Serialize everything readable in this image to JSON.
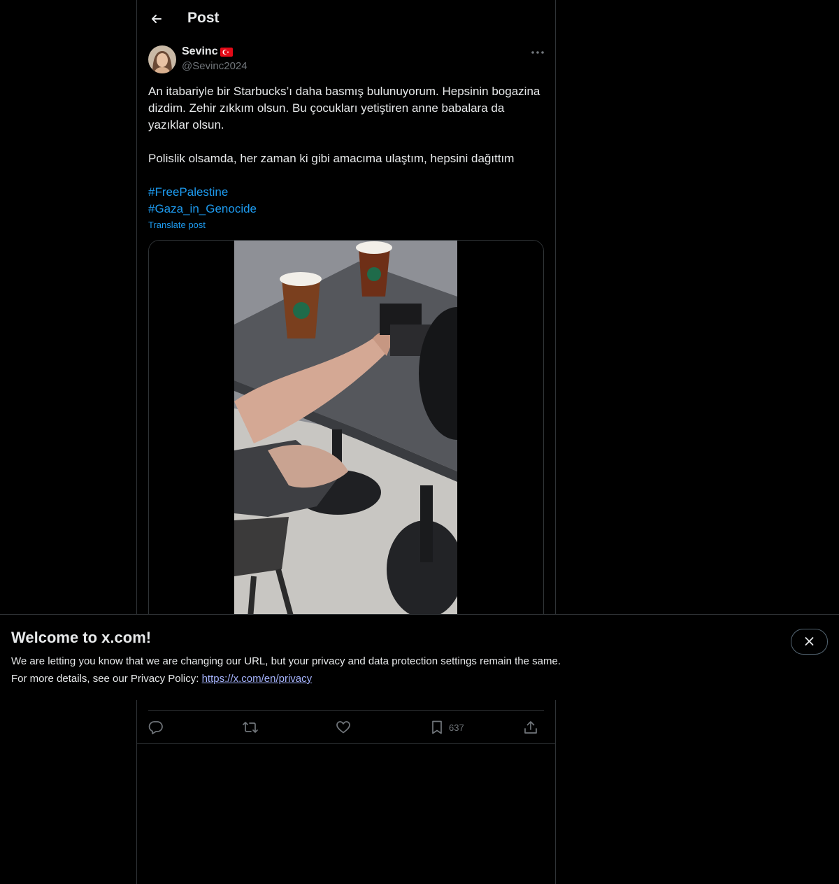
{
  "header": {
    "title": "Post"
  },
  "author": {
    "name": "Sevinc",
    "handle": "@Sevinc2024"
  },
  "post": {
    "paragraphs": [
      "An itabariyle bir Starbucks’ı daha basmış bulunuyorum. Hepsinin bogazina dizdim. Zehir zıkkım olsun. Bu çocukları yetiştiren anne babalara da yazıklar olsun.",
      "Polislik olsamda, her zaman ki gibi amacıma ulaştım, hepsini dağıttım"
    ],
    "hashtags": [
      "#FreePalestine",
      "#Gaza_in_Genocide"
    ],
    "translate_label": "Translate post"
  },
  "actions": {
    "reply_count": "",
    "repost_count": "",
    "like_count": "",
    "bookmark_count": "637"
  },
  "banner": {
    "title": "Welcome to x.com!",
    "line1": "We are letting you know that we are changing our URL, but your privacy and data protection settings remain the same.",
    "line2_prefix": "For more details, see our Privacy Policy: ",
    "link": "https://x.com/en/privacy"
  },
  "icons": {
    "back": "arrow-left-icon",
    "more": "more-horizontal-icon",
    "reply": "reply-icon",
    "repost": "repost-icon",
    "like": "heart-icon",
    "bookmark": "bookmark-icon",
    "share": "share-icon",
    "close": "close-icon"
  },
  "colors": {
    "accent": "#1d9bf0",
    "background": "#000000",
    "muted": "#71767b",
    "border": "#2f3336"
  }
}
